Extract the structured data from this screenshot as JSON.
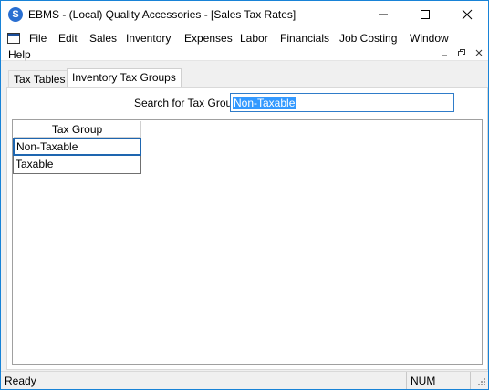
{
  "window": {
    "title": "EBMS - (Local) Quality Accessories - [Sales Tax Rates]",
    "app_icon_glyph": "S"
  },
  "menu": {
    "items": [
      "File",
      "Edit",
      "Sales",
      "Inventory",
      "Expenses",
      "Labor",
      "Financials",
      "Job Costing",
      "Window",
      "Help"
    ]
  },
  "tabs": {
    "items": [
      "Tax Tables",
      "Inventory Tax Groups"
    ],
    "active": "Inventory Tax Groups"
  },
  "search": {
    "label": "Search for Tax Group",
    "value": "Non-Taxable"
  },
  "grid": {
    "header": "Tax Group",
    "rows": [
      "Non-Taxable",
      "Taxable"
    ]
  },
  "status": {
    "left": "Ready",
    "num": "NUM"
  },
  "colors": {
    "accent": "#1883d7",
    "selection": "#3399ff",
    "focus_border": "#1e66b0"
  }
}
